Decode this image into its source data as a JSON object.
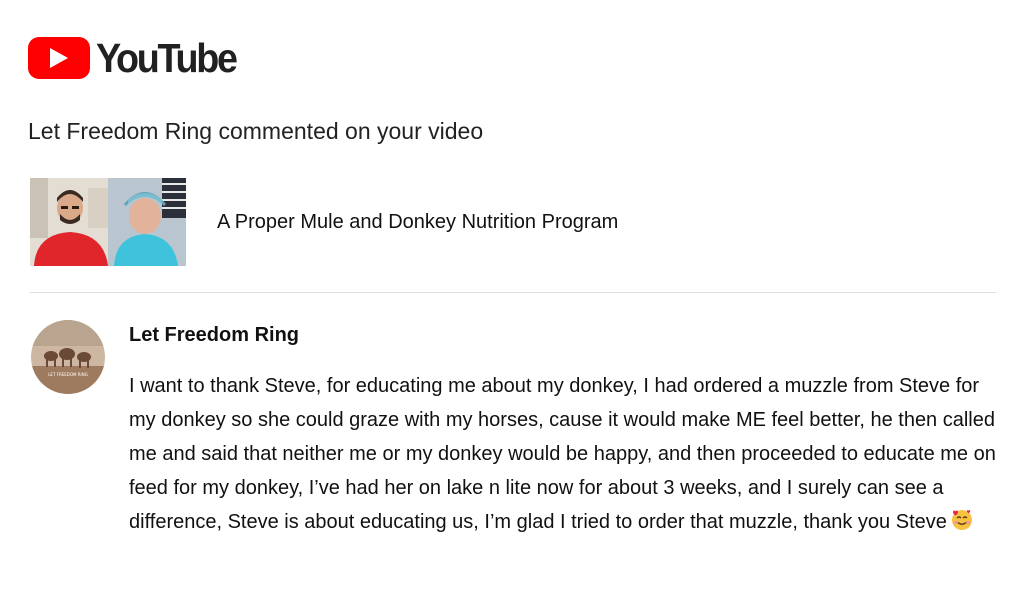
{
  "brand": {
    "logo_text": "YouTube",
    "accent_color": "#ff0000",
    "play_icon": "play-icon"
  },
  "notification": {
    "headline": "Let Freedom Ring commented on your video"
  },
  "video": {
    "title": "A Proper Mule and Donkey Nutrition Program",
    "thumbnail_icon": "video-thumbnail"
  },
  "comment": {
    "author": "Let Freedom Ring",
    "avatar_text": "LET FREEDOM RING",
    "text": "I want to thank Steve, for educating me about my donkey, I had ordered a muzzle from Steve for my donkey so she could graze with my horses, cause it would make ME feel better, he then called me and said that neither me or my donkey would be happy, and then proceeded to educate me on feed for my donkey, I’ve had her on lake n lite now for about 3 weeks, and I surely can see a difference, Steve is about educating us, I’m glad I tried to order that muzzle, thank you Steve",
    "emoji": "smiling-face-with-hearts-emoji"
  }
}
